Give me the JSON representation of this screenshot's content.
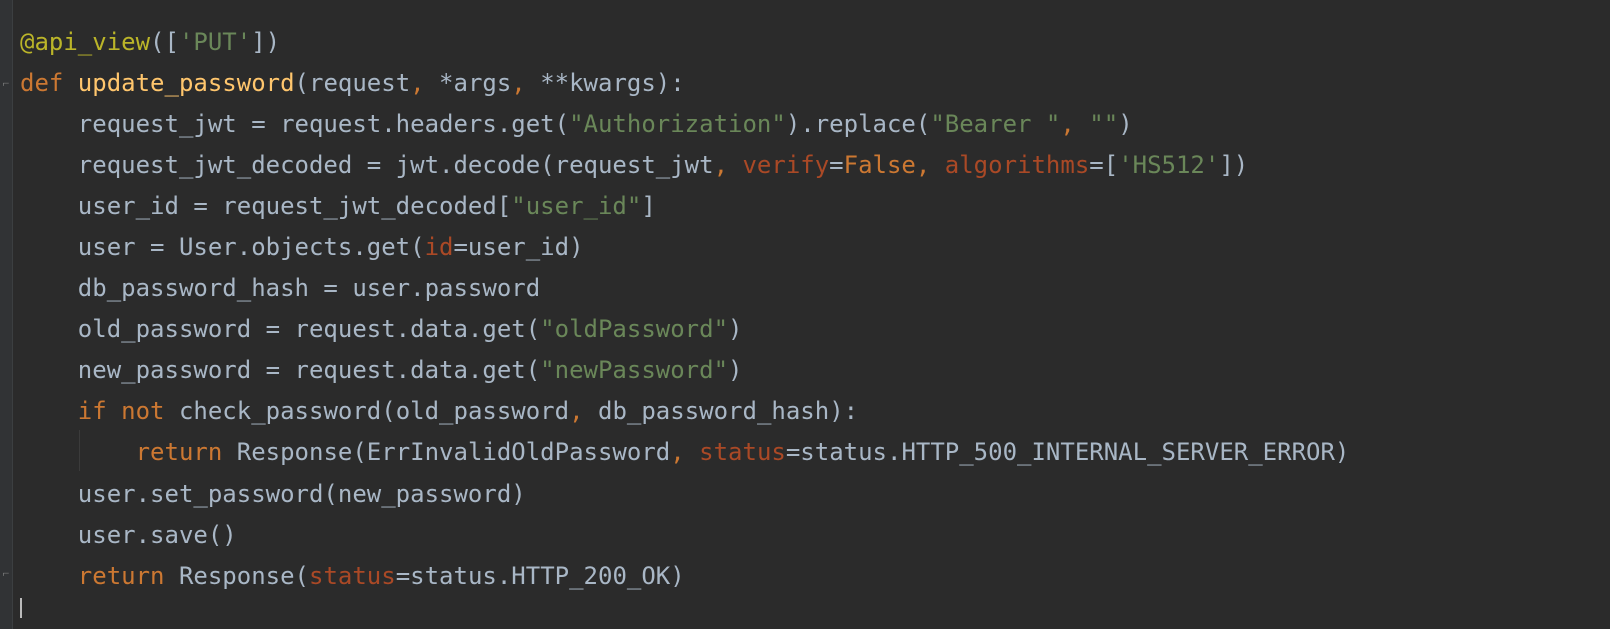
{
  "editor": {
    "lines": [
      [
        {
          "t": "@api_view",
          "c": "dec"
        },
        {
          "t": "([",
          "c": "plain"
        },
        {
          "t": "'PUT'",
          "c": "str"
        },
        {
          "t": "])",
          "c": "plain"
        }
      ],
      [
        {
          "t": "def ",
          "c": "kw"
        },
        {
          "t": "update_password",
          "c": "fn"
        },
        {
          "t": "(request",
          "c": "plain"
        },
        {
          "t": ", ",
          "c": "punc"
        },
        {
          "t": "*args",
          "c": "plain"
        },
        {
          "t": ", ",
          "c": "punc"
        },
        {
          "t": "**kwargs):",
          "c": "plain"
        }
      ],
      [
        {
          "t": "    request_jwt = request.headers.get(",
          "c": "plain"
        },
        {
          "t": "\"Authorization\"",
          "c": "str"
        },
        {
          "t": ").replace(",
          "c": "plain"
        },
        {
          "t": "\"Bearer \"",
          "c": "str"
        },
        {
          "t": ", ",
          "c": "punc"
        },
        {
          "t": "\"\"",
          "c": "str"
        },
        {
          "t": ")",
          "c": "plain"
        }
      ],
      [
        {
          "t": "    request_jwt_decoded = jwt.decode(request_jwt",
          "c": "plain"
        },
        {
          "t": ", ",
          "c": "punc"
        },
        {
          "t": "verify",
          "c": "param"
        },
        {
          "t": "=",
          "c": "plain"
        },
        {
          "t": "False",
          "c": "kw"
        },
        {
          "t": ", ",
          "c": "punc"
        },
        {
          "t": "algorithms",
          "c": "param"
        },
        {
          "t": "=[",
          "c": "plain"
        },
        {
          "t": "'HS512'",
          "c": "str"
        },
        {
          "t": "])",
          "c": "plain"
        }
      ],
      [
        {
          "t": "    user_id = request_jwt_decoded[",
          "c": "plain"
        },
        {
          "t": "\"user_id\"",
          "c": "str"
        },
        {
          "t": "]",
          "c": "plain"
        }
      ],
      [
        {
          "t": "    user = User.objects.get(",
          "c": "plain"
        },
        {
          "t": "id",
          "c": "param"
        },
        {
          "t": "=user_id)",
          "c": "plain"
        }
      ],
      [
        {
          "t": "    db_password_hash = user.password",
          "c": "plain"
        }
      ],
      [
        {
          "t": "    old_password = request.data.get(",
          "c": "plain"
        },
        {
          "t": "\"oldPassword\"",
          "c": "str"
        },
        {
          "t": ")",
          "c": "plain"
        }
      ],
      [
        {
          "t": "    new_password = request.data.get(",
          "c": "plain"
        },
        {
          "t": "\"newPassword\"",
          "c": "str"
        },
        {
          "t": ")",
          "c": "plain"
        }
      ],
      [
        {
          "t": "    ",
          "c": "plain"
        },
        {
          "t": "if not ",
          "c": "kw"
        },
        {
          "t": "check_password(old_password",
          "c": "plain"
        },
        {
          "t": ", ",
          "c": "punc"
        },
        {
          "t": "db_password_hash):",
          "c": "plain"
        }
      ],
      [
        {
          "t": "        ",
          "c": "plain"
        },
        {
          "t": "return ",
          "c": "kw"
        },
        {
          "t": "Response(ErrInvalidOldPassword",
          "c": "plain"
        },
        {
          "t": ", ",
          "c": "punc"
        },
        {
          "t": "status",
          "c": "param"
        },
        {
          "t": "=status.HTTP_500_INTERNAL_SERVER_ERROR)",
          "c": "plain"
        }
      ],
      [
        {
          "t": "    user.set_password(new_password)",
          "c": "plain"
        }
      ],
      [
        {
          "t": "    user.save()",
          "c": "plain"
        }
      ],
      [
        {
          "t": "    ",
          "c": "plain"
        },
        {
          "t": "return ",
          "c": "kw"
        },
        {
          "t": "Response(",
          "c": "plain"
        },
        {
          "t": "status",
          "c": "param"
        },
        {
          "t": "=status.HTTP_200_OK)",
          "c": "plain"
        }
      ]
    ]
  },
  "gutter": {
    "fold_icon": "fold-marker-icon"
  },
  "colors": {
    "background": "#2b2b2b",
    "keyword": "#cc7832",
    "function": "#ffc66d",
    "string": "#6a8759",
    "decorator": "#bbb529",
    "parameter": "#aa4926",
    "text": "#a9b7c6"
  }
}
